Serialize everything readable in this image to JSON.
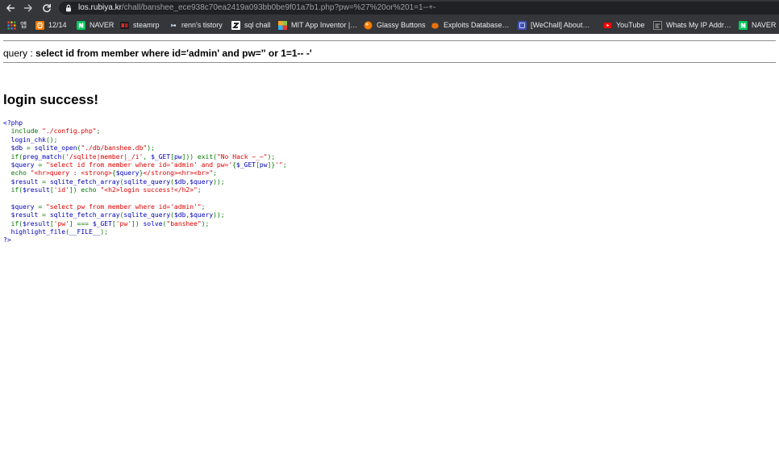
{
  "browser": {
    "url_host": "los.rubiya.kr",
    "url_path": "/chall/banshee_ece938c70ea2419a093bb0be9f01a7b1.php?pw=%27%20or%201=1--+-",
    "nav_icons": {
      "back": "back-arrow-icon",
      "forward": "forward-arrow-icon",
      "reload": "reload-icon",
      "secure": "lock-icon"
    },
    "bookmarks": [
      {
        "label": "앱",
        "icon": "apps-grid-icon"
      },
      {
        "label": "12/14",
        "icon": "blogger-icon"
      },
      {
        "label": "NAVER",
        "icon": "naver-icon"
      },
      {
        "label": "steamrp",
        "icon": "steamrp-icon"
      },
      {
        "label": "renn's tistory",
        "icon": "tistory-icon"
      },
      {
        "label": "sql chall",
        "icon": "z-icon"
      },
      {
        "label": "MIT App Inventor |…",
        "icon": "mit-app-inventor-icon"
      },
      {
        "label": "Glassy Buttons",
        "icon": "glassy-buttons-icon"
      },
      {
        "label": "Exploits Database…",
        "icon": "exploit-db-icon"
      },
      {
        "label": "[WeChall] About…",
        "icon": "wechall-icon"
      },
      {
        "label": "YouTube",
        "icon": "youtube-icon"
      },
      {
        "label": "Whats My IP Addr…",
        "icon": "whats-my-ip-icon"
      },
      {
        "label": "NAVER",
        "icon": "naver-icon"
      }
    ]
  },
  "page": {
    "query_label": "query : ",
    "query_text": "select id from member where id='admin' and pw='' or 1=1-- -'",
    "status_heading": "login success!",
    "code_lines": [
      [
        {
          "t": "<?php",
          "c": "#0000BB"
        }
      ],
      [
        {
          "t": "  include ",
          "c": "#007700"
        },
        {
          "t": "\"./config.php\"",
          "c": "#DD0000"
        },
        {
          "t": ";",
          "c": "#007700"
        }
      ],
      [
        {
          "t": "  login_chk",
          "c": "#0000BB"
        },
        {
          "t": "();",
          "c": "#007700"
        }
      ],
      [
        {
          "t": "  $db",
          "c": "#0000BB"
        },
        {
          "t": " = ",
          "c": "#007700"
        },
        {
          "t": "sqlite_open",
          "c": "#0000BB"
        },
        {
          "t": "(",
          "c": "#007700"
        },
        {
          "t": "\"./db/banshee.db\"",
          "c": "#DD0000"
        },
        {
          "t": ");",
          "c": "#007700"
        }
      ],
      [
        {
          "t": "  if(",
          "c": "#007700"
        },
        {
          "t": "preg_match",
          "c": "#0000BB"
        },
        {
          "t": "(",
          "c": "#007700"
        },
        {
          "t": "'/sqlite|member|_/i'",
          "c": "#DD0000"
        },
        {
          "t": ", ",
          "c": "#007700"
        },
        {
          "t": "$_GET",
          "c": "#0000BB"
        },
        {
          "t": "[",
          "c": "#007700"
        },
        {
          "t": "pw",
          "c": "#0000BB"
        },
        {
          "t": "])) exit(",
          "c": "#007700"
        },
        {
          "t": "\"No Hack ~_~\"",
          "c": "#DD0000"
        },
        {
          "t": ");",
          "c": "#007700"
        }
      ],
      [
        {
          "t": "  $query",
          "c": "#0000BB"
        },
        {
          "t": " = ",
          "c": "#007700"
        },
        {
          "t": "\"select id from member where id='admin' and pw='",
          "c": "#DD0000"
        },
        {
          "t": "{",
          "c": "#007700"
        },
        {
          "t": "$_GET",
          "c": "#0000BB"
        },
        {
          "t": "[",
          "c": "#007700"
        },
        {
          "t": "pw",
          "c": "#0000BB"
        },
        {
          "t": "]}",
          "c": "#007700"
        },
        {
          "t": "'\"",
          "c": "#DD0000"
        },
        {
          "t": ";",
          "c": "#007700"
        }
      ],
      [
        {
          "t": "  echo ",
          "c": "#007700"
        },
        {
          "t": "\"<hr>query : <strong>",
          "c": "#DD0000"
        },
        {
          "t": "{",
          "c": "#007700"
        },
        {
          "t": "$query",
          "c": "#0000BB"
        },
        {
          "t": "}",
          "c": "#007700"
        },
        {
          "t": "</strong><hr><br>\"",
          "c": "#DD0000"
        },
        {
          "t": ";",
          "c": "#007700"
        }
      ],
      [
        {
          "t": "  $result",
          "c": "#0000BB"
        },
        {
          "t": " = ",
          "c": "#007700"
        },
        {
          "t": "sqlite_fetch_array",
          "c": "#0000BB"
        },
        {
          "t": "(",
          "c": "#007700"
        },
        {
          "t": "sqlite_query",
          "c": "#0000BB"
        },
        {
          "t": "(",
          "c": "#007700"
        },
        {
          "t": "$db",
          "c": "#0000BB"
        },
        {
          "t": ",",
          "c": "#007700"
        },
        {
          "t": "$query",
          "c": "#0000BB"
        },
        {
          "t": "));",
          "c": "#007700"
        }
      ],
      [
        {
          "t": "  if(",
          "c": "#007700"
        },
        {
          "t": "$result",
          "c": "#0000BB"
        },
        {
          "t": "[",
          "c": "#007700"
        },
        {
          "t": "'id'",
          "c": "#DD0000"
        },
        {
          "t": "]) echo ",
          "c": "#007700"
        },
        {
          "t": "\"<h2>login success!</h2>\"",
          "c": "#DD0000"
        },
        {
          "t": ";",
          "c": "#007700"
        }
      ],
      [],
      [
        {
          "t": "  $query",
          "c": "#0000BB"
        },
        {
          "t": " = ",
          "c": "#007700"
        },
        {
          "t": "\"select pw from member where id='admin'\"",
          "c": "#DD0000"
        },
        {
          "t": ";",
          "c": "#007700"
        }
      ],
      [
        {
          "t": "  $result",
          "c": "#0000BB"
        },
        {
          "t": " = ",
          "c": "#007700"
        },
        {
          "t": "sqlite_fetch_array",
          "c": "#0000BB"
        },
        {
          "t": "(",
          "c": "#007700"
        },
        {
          "t": "sqlite_query",
          "c": "#0000BB"
        },
        {
          "t": "(",
          "c": "#007700"
        },
        {
          "t": "$db",
          "c": "#0000BB"
        },
        {
          "t": ",",
          "c": "#007700"
        },
        {
          "t": "$query",
          "c": "#0000BB"
        },
        {
          "t": "));",
          "c": "#007700"
        }
      ],
      [
        {
          "t": "  if(",
          "c": "#007700"
        },
        {
          "t": "$result",
          "c": "#0000BB"
        },
        {
          "t": "[",
          "c": "#007700"
        },
        {
          "t": "'pw'",
          "c": "#DD0000"
        },
        {
          "t": "] === ",
          "c": "#007700"
        },
        {
          "t": "$_GET",
          "c": "#0000BB"
        },
        {
          "t": "[",
          "c": "#007700"
        },
        {
          "t": "'pw'",
          "c": "#DD0000"
        },
        {
          "t": "]) ",
          "c": "#007700"
        },
        {
          "t": "solve",
          "c": "#0000BB"
        },
        {
          "t": "(",
          "c": "#007700"
        },
        {
          "t": "\"banshee\"",
          "c": "#DD0000"
        },
        {
          "t": ");",
          "c": "#007700"
        }
      ],
      [
        {
          "t": "  highlight_file",
          "c": "#0000BB"
        },
        {
          "t": "(",
          "c": "#007700"
        },
        {
          "t": "__FILE__",
          "c": "#0000BB"
        },
        {
          "t": ");",
          "c": "#007700"
        }
      ],
      [
        {
          "t": "?>",
          "c": "#0000BB"
        }
      ]
    ]
  },
  "colors": {
    "toolbar_bg": "#35363a",
    "omnibox_bg": "#202124",
    "chrome_text": "#e8eaed",
    "url_dim": "#9aa0a6",
    "page_bg": "#ffffff",
    "text": "#000000",
    "rule": "#8e8e8e"
  }
}
